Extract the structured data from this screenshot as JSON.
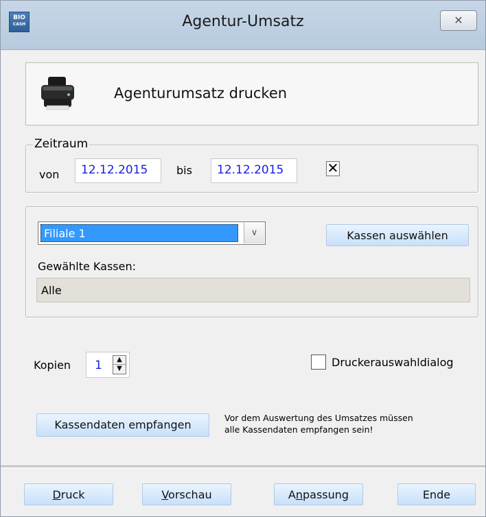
{
  "window": {
    "title": "Agentur-Umsatz",
    "app_icon_text": "BIO",
    "app_icon_subtext": "CASH",
    "close_label": "✕"
  },
  "header": {
    "text": "Agenturumsatz drucken"
  },
  "zeitraum": {
    "legend": "Zeitraum",
    "von_label": "von",
    "von_value": "12.12.2015",
    "bis_label": "bis",
    "bis_value": "12.12.2015",
    "clear_symbol": "✕"
  },
  "filiale": {
    "selected": "Filiale 1",
    "kassen_button": "Kassen auswählen",
    "gewaehlte_label": "Gewählte Kassen:",
    "gewaehlte_value": "Alle"
  },
  "kopien": {
    "label": "Kopien",
    "value": "1",
    "up_symbol": "▲",
    "down_symbol": "▼"
  },
  "druckerauswahl": {
    "label": "Druckerauswahldialog",
    "checked": false
  },
  "kassendaten": {
    "button": "Kassendaten empfangen",
    "note_line1": "Vor dem Auswertung des Umsatzes müssen",
    "note_line2": "alle Kassendaten empfangen sein!"
  },
  "footer": {
    "druck_first": "D",
    "druck_rest": "ruck",
    "vorschau_first": "V",
    "vorschau_rest": "orschau",
    "anpassung_pre": "A",
    "anpassung_under": "n",
    "anpassung_rest": "passung",
    "ende": "Ende"
  },
  "colors": {
    "titlebar": "#b7cade",
    "button": "#c7e0fa",
    "input_text": "#1a1ae6",
    "selection": "#3399ff"
  }
}
